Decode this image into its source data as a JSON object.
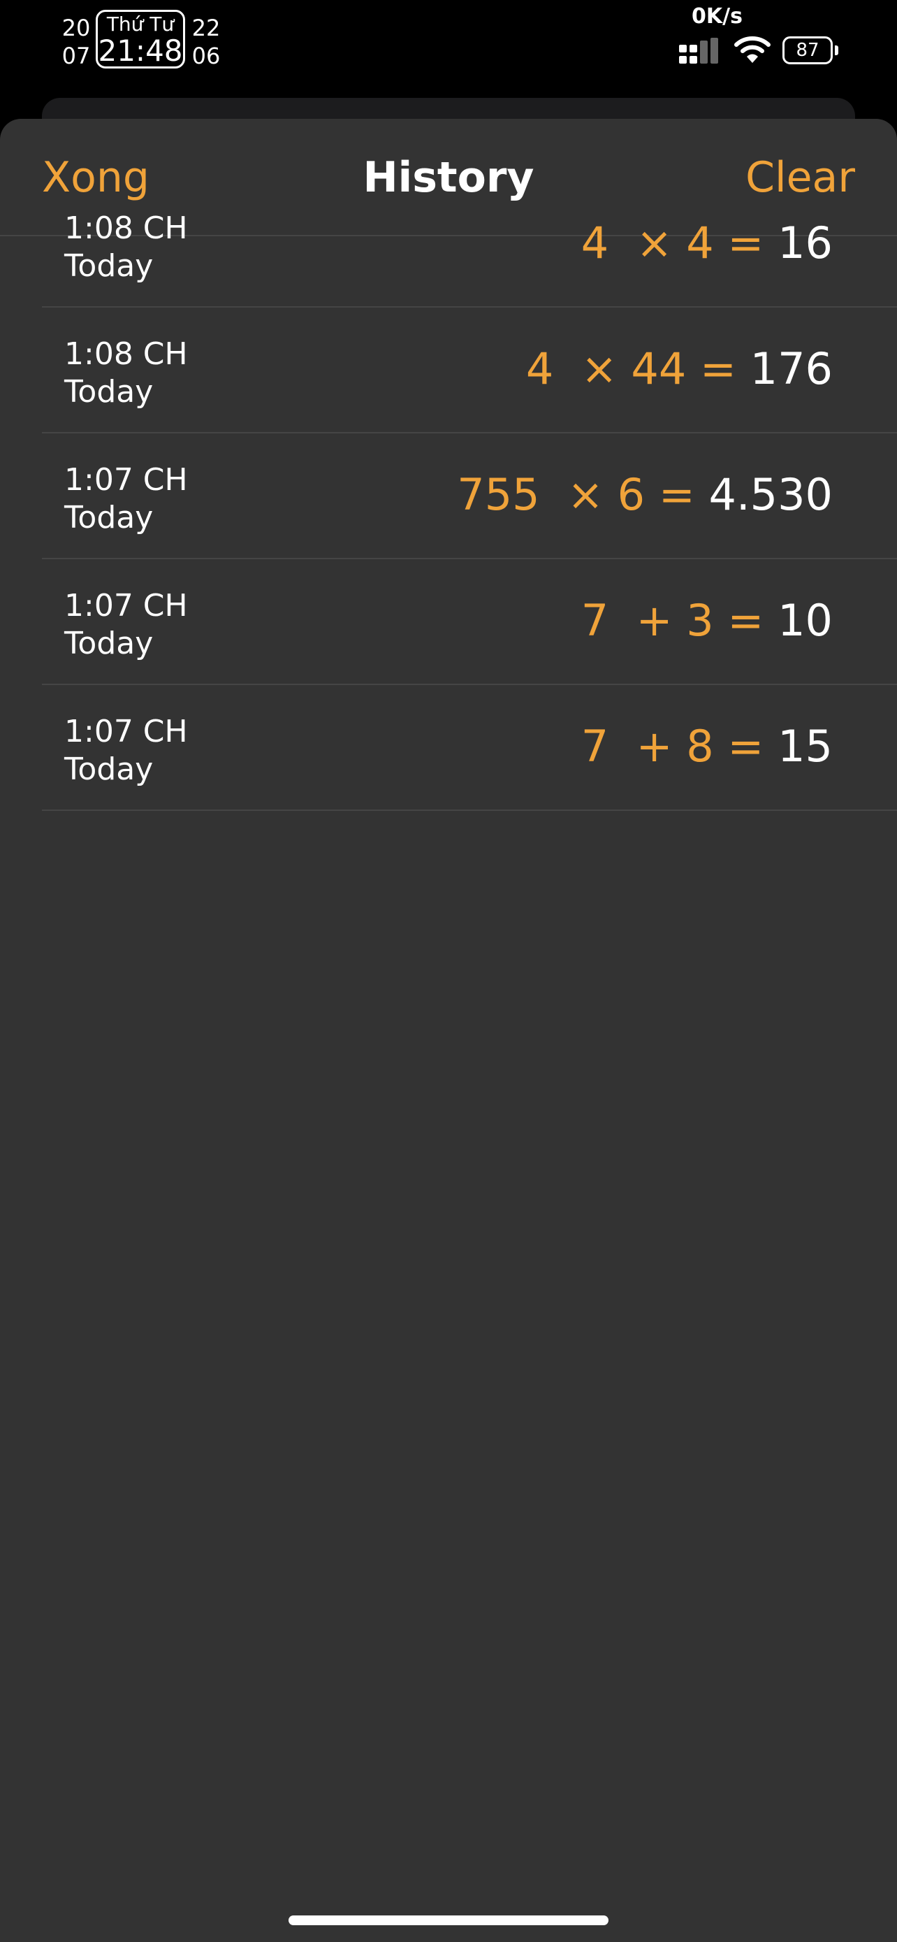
{
  "status_bar": {
    "date_left_top": "20",
    "date_left_bottom": "07",
    "weekday": "Thứ Tư",
    "time": "21:48",
    "date_right_top": "22",
    "date_right_bottom": "06",
    "net_speed": "0K/s",
    "battery": "87"
  },
  "nav": {
    "done_label": "Xong",
    "title": "History",
    "clear_label": "Clear"
  },
  "history": [
    {
      "time": "1:08 CH",
      "day": "Today",
      "expression": "4  × 4 = ",
      "result": "16"
    },
    {
      "time": "1:08 CH",
      "day": "Today",
      "expression": "4  × 44 = ",
      "result": "176"
    },
    {
      "time": "1:07 CH",
      "day": "Today",
      "expression": "755  × 6 = ",
      "result": "4.530"
    },
    {
      "time": "1:07 CH",
      "day": "Today",
      "expression": "7  + 3 = ",
      "result": "10"
    },
    {
      "time": "1:07 CH",
      "day": "Today",
      "expression": "7  + 8 = ",
      "result": "15"
    }
  ],
  "colors": {
    "accent": "#f0a33a",
    "sheet_bg": "#333333",
    "separator": "#454545"
  }
}
